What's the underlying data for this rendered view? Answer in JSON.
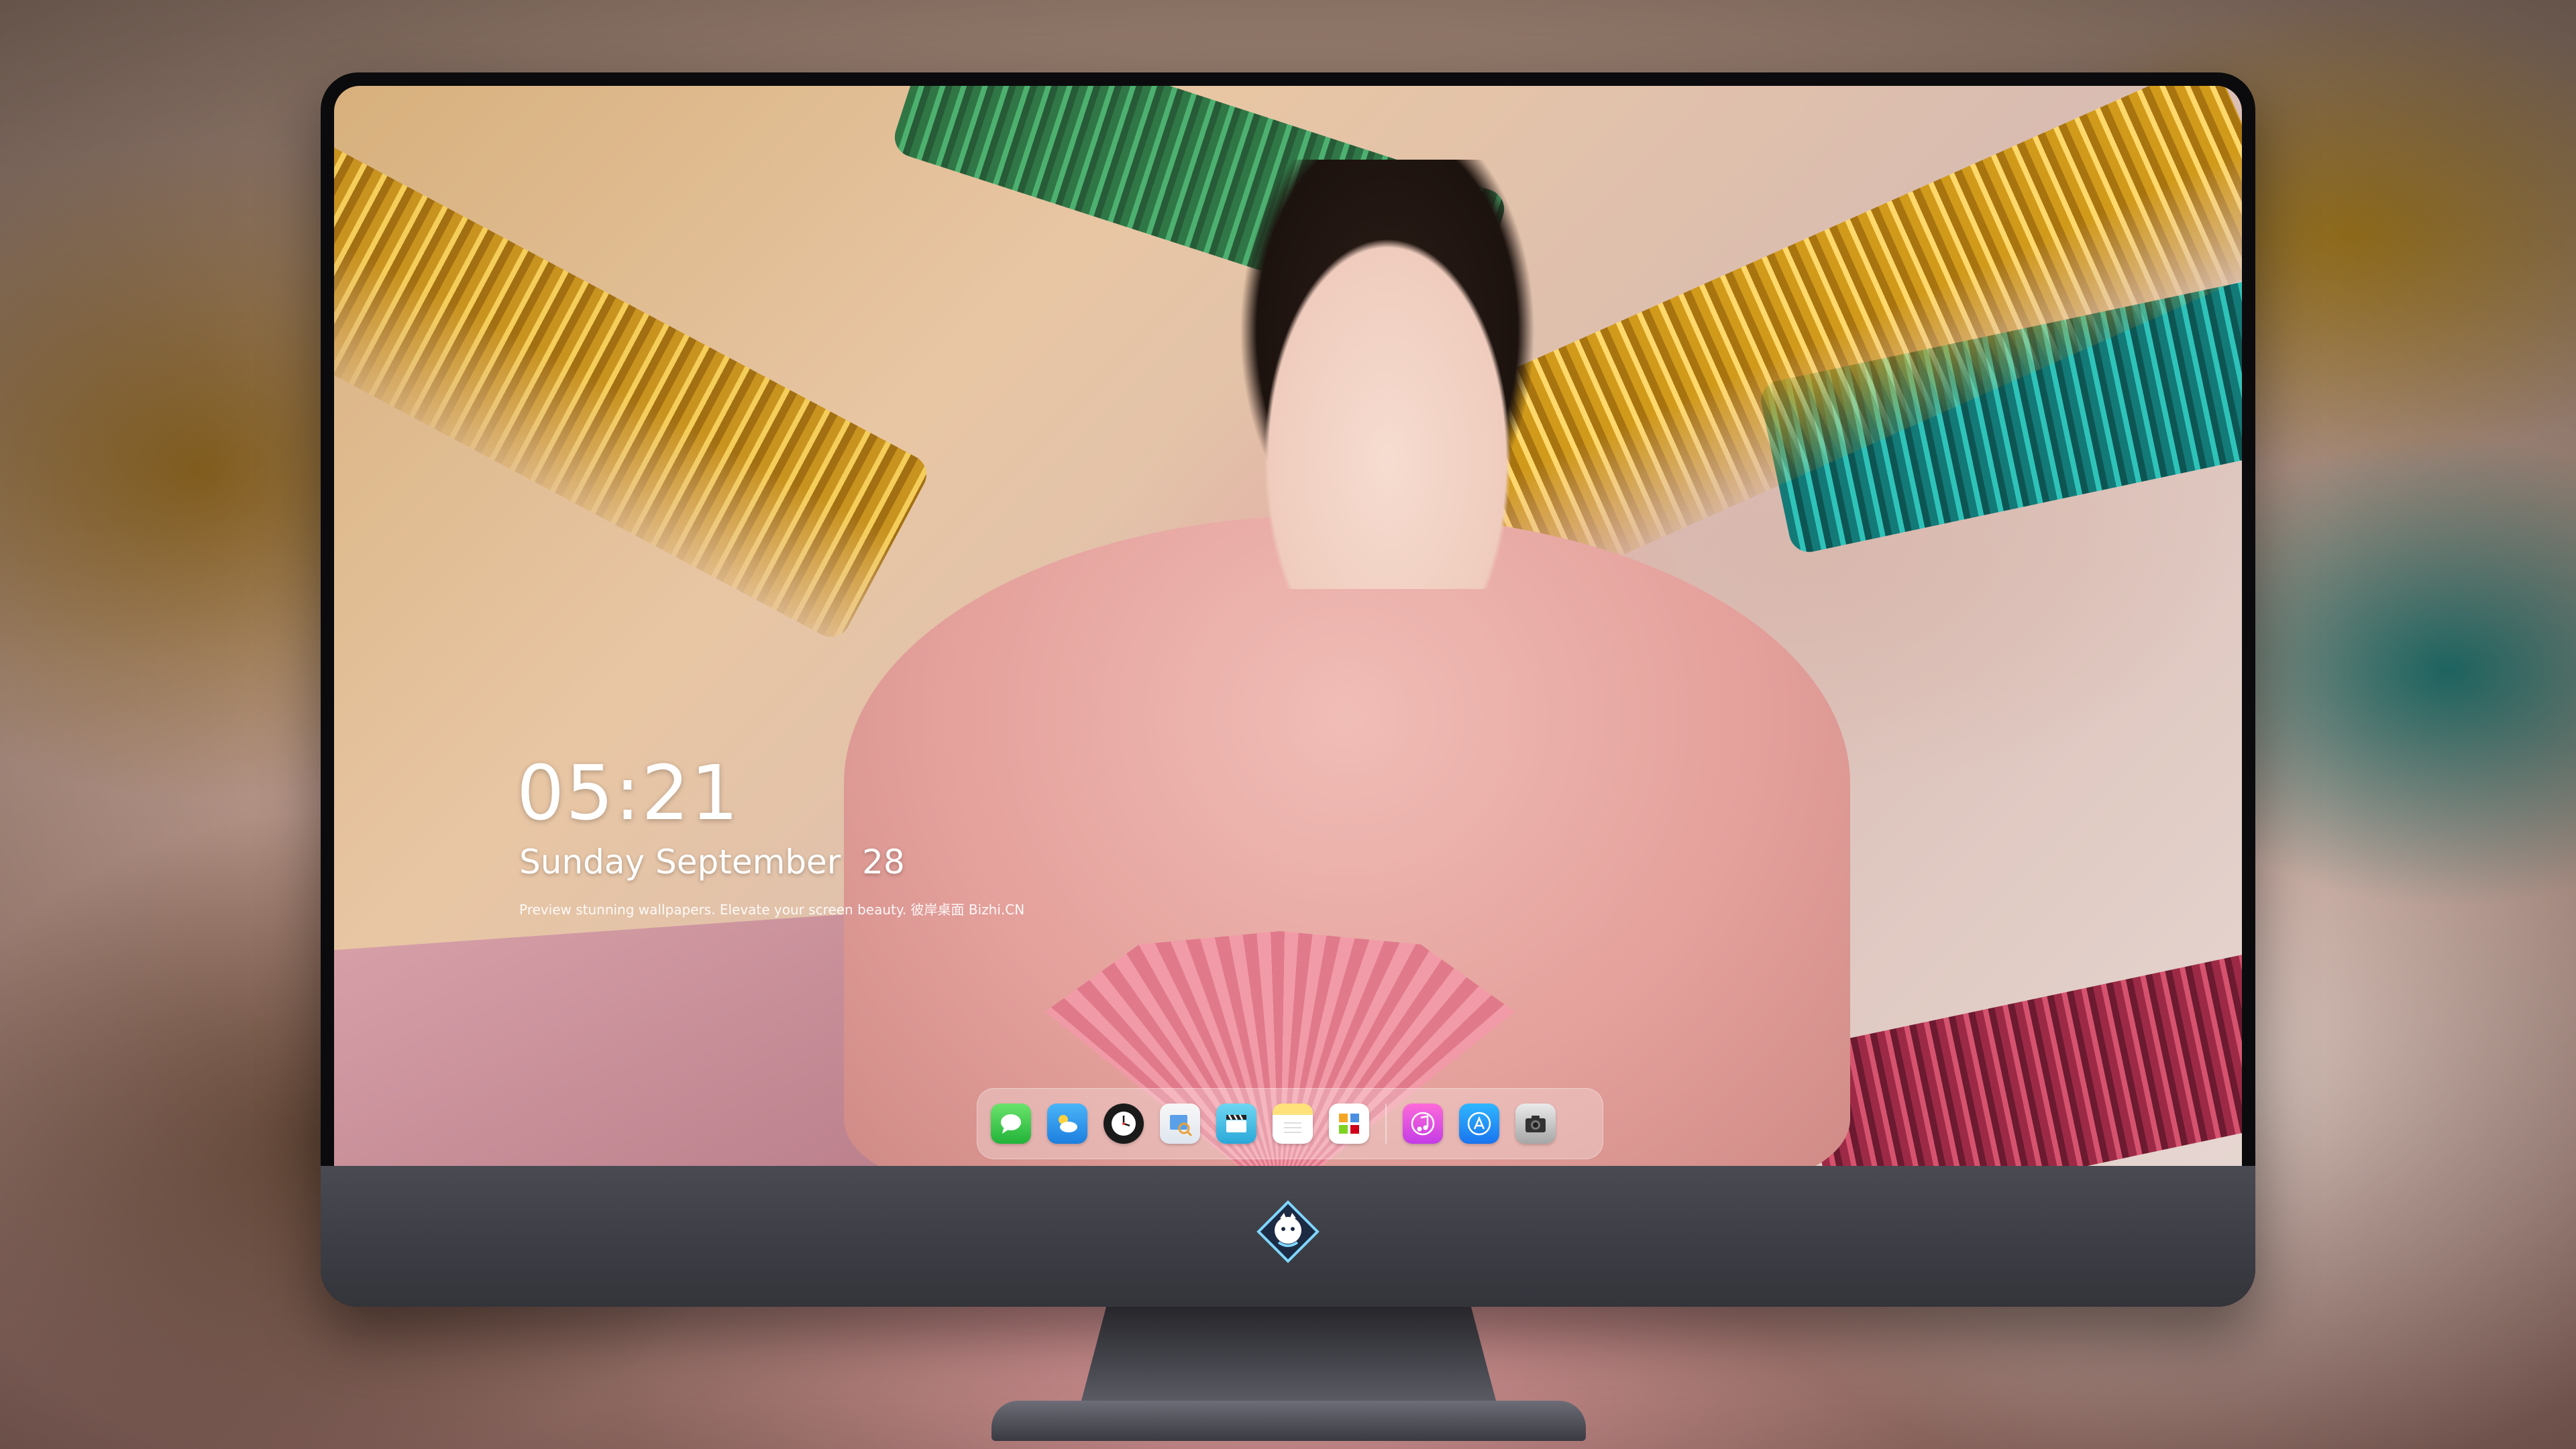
{
  "lock_screen": {
    "time": "05:21",
    "date": "Sunday September  28",
    "tagline": "Preview stunning wallpapers. Elevate your screen beauty. 彼岸桌面 Bizhi.CN"
  },
  "dock": {
    "apps": [
      {
        "icon": "messages-icon"
      },
      {
        "icon": "weather-icon"
      },
      {
        "icon": "clock-icon"
      },
      {
        "icon": "preview-icon"
      },
      {
        "icon": "video-clapper-icon"
      },
      {
        "icon": "notes-icon"
      },
      {
        "icon": "photos-grid-icon"
      },
      {
        "icon": "music-icon"
      },
      {
        "icon": "app-store-icon"
      },
      {
        "icon": "camera-icon"
      }
    ]
  },
  "monitor": {
    "chin_logo": "mascot-logo-icon"
  },
  "colors": {
    "dock_background": "rgba(255,255,255,0.28)",
    "bezel": "#0b0b0d",
    "chin": "#3c3c44",
    "text": "#ffffff"
  }
}
